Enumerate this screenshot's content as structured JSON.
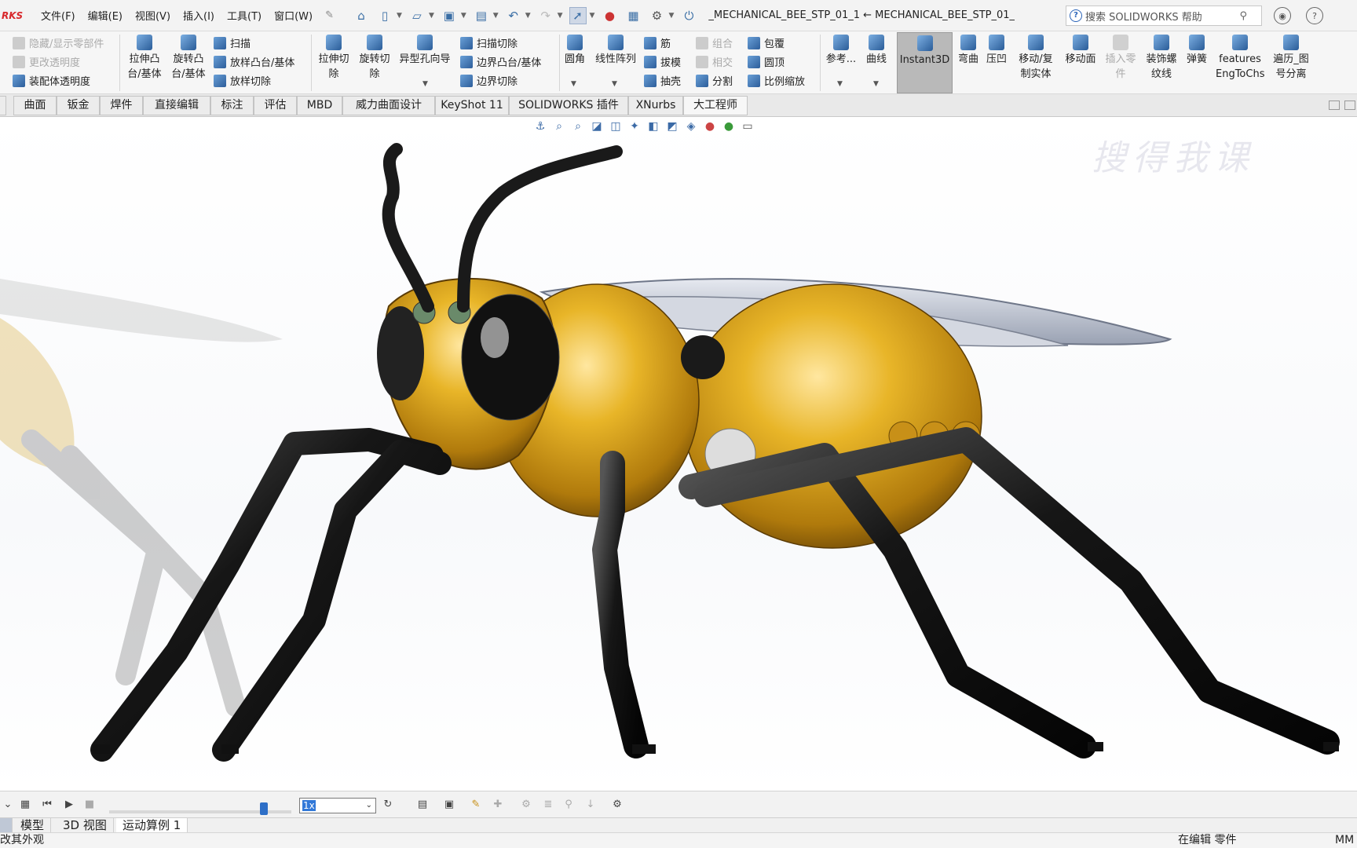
{
  "app": {
    "logo": "RKS",
    "doc_title": "_MECHANICAL_BEE_STP_01_1 ← MECHANICAL_BEE_STP_01_..."
  },
  "menu": [
    "文件(F)",
    "编辑(E)",
    "视图(V)",
    "插入(I)",
    "工具(T)",
    "窗口(W)"
  ],
  "search": {
    "placeholder": "搜索 SOLIDWORKS 帮助",
    "help_icon": "?"
  },
  "ribbon": {
    "assembly": {
      "hide_show": "隐藏/显示零部件",
      "change_transparency": "更改透明度",
      "assembly_transparency": "装配体透明度"
    },
    "extrude_boss": [
      "拉伸凸",
      "台/基体"
    ],
    "revolve_boss": [
      "旋转凸",
      "台/基体"
    ],
    "sweep": "扫描",
    "loft_boss": "放样凸台/基体",
    "loft_cut": "放样切除",
    "extrude_cut": [
      "拉伸切",
      "除"
    ],
    "revolve_cut": [
      "旋转切",
      "除"
    ],
    "hole_wizard": "异型孔向导",
    "sweep_cut": "扫描切除",
    "boundary_boss": "边界凸台/基体",
    "boundary_cut": "边界切除",
    "fillet": "圆角",
    "linear_pattern": "线性阵列",
    "rib": "筋",
    "draft": "拔模",
    "shell": "抽壳",
    "combine": "组合",
    "intersect": "相交",
    "split": "分割",
    "wrap": "包覆",
    "dome": "圆顶",
    "scale": "比例缩放",
    "reference": "参考...",
    "curves": "曲线",
    "instant3d": "Instant3D",
    "flex": "弯曲",
    "indent": "压凹",
    "move_copy": [
      "移动/复",
      "制实体"
    ],
    "move_face": "移动面",
    "insert_part": [
      "插入零",
      "件"
    ],
    "cosmetic_thread": [
      "装饰螺",
      "纹线"
    ],
    "spring": "弹簧",
    "features_eng": [
      "features",
      "EngToChs"
    ],
    "traverse": [
      "遍历_图",
      "号分离"
    ]
  },
  "tabs": [
    "曲面",
    "钣金",
    "焊件",
    "直接编辑",
    "标注",
    "评估",
    "MBD",
    "威力曲面设计",
    "KeyShot 11",
    "SOLIDWORKS 插件",
    "XNurbs",
    "大工程师"
  ],
  "watermark": "搜得我课",
  "motion": {
    "speed": "1x",
    "playback_position": 0.85
  },
  "bottom_tabs": [
    "模型",
    "3D 视图",
    "运动算例 1"
  ],
  "status": {
    "left": "改其外观",
    "right_state": "在编辑 零件",
    "units": "MM"
  },
  "colors": {
    "body_gold": "#e0a81e",
    "leg_black": "#141414",
    "wing_silver": "#c7cdd8",
    "selection_blue": "#2e6fc7",
    "active_gray": "#b9b9b9"
  }
}
